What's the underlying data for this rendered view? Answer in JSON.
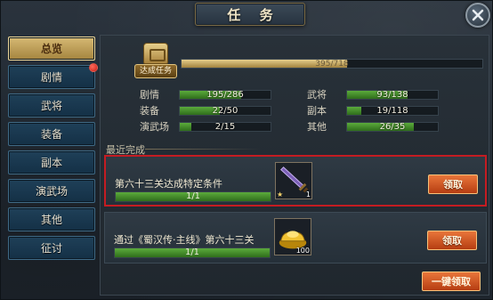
{
  "window": {
    "title": "任 务"
  },
  "sidebar": {
    "items": [
      {
        "label": "总览",
        "active": true,
        "dot": false
      },
      {
        "label": "剧情",
        "active": false,
        "dot": true
      },
      {
        "label": "武将",
        "active": false,
        "dot": false
      },
      {
        "label": "装备",
        "active": false,
        "dot": false
      },
      {
        "label": "副本",
        "active": false,
        "dot": false
      },
      {
        "label": "演武场",
        "active": false,
        "dot": false
      },
      {
        "label": "其他",
        "active": false,
        "dot": false
      },
      {
        "label": "征讨",
        "active": false,
        "dot": false
      }
    ]
  },
  "achievement": {
    "badge_label": "达成任务",
    "progress_text": "395/718",
    "progress": 0.55,
    "colors": {
      "gold": "#d6b973"
    }
  },
  "stats": [
    {
      "label": "剧情",
      "text": "195/286",
      "progress": 0.68
    },
    {
      "label": "武将",
      "text": "93/138",
      "progress": 0.67
    },
    {
      "label": "装备",
      "text": "22/50",
      "progress": 0.44
    },
    {
      "label": "副本",
      "text": "19/118",
      "progress": 0.16
    },
    {
      "label": "演武场",
      "text": "2/15",
      "progress": 0.13
    },
    {
      "label": "其他",
      "text": "26/35",
      "progress": 0.74
    }
  ],
  "recent": {
    "label": "最近完成",
    "tasks": [
      {
        "title": "第六十三关达成特定条件",
        "progress_text": "1/1",
        "progress": 1.0,
        "reward_icon": "sword-icon",
        "reward_qty": "1",
        "claim_label": "领取",
        "highlighted": true
      },
      {
        "title": "通过《蜀汉传·主线》第六十三关",
        "progress_text": "1/1",
        "progress": 1.0,
        "reward_icon": "gold-ingot-icon",
        "reward_qty": "100",
        "claim_label": "领取",
        "highlighted": false
      }
    ]
  },
  "one_click_label": "一键领取",
  "colors": {
    "accent_red": "#c41c22",
    "button_orange": "#e9763a",
    "bar_green": "#5cab3c"
  }
}
